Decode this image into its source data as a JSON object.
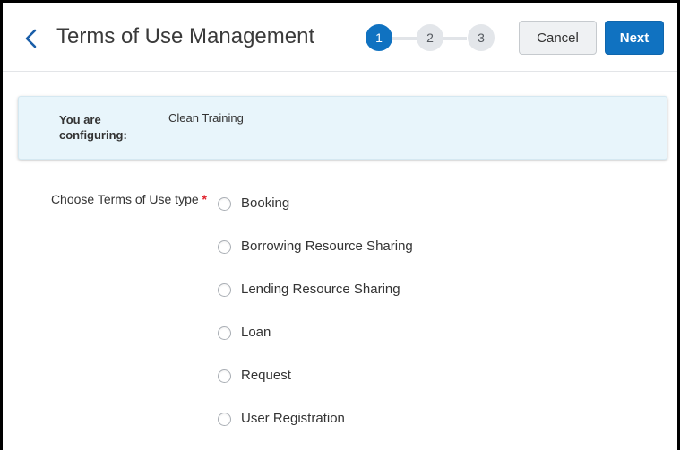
{
  "header": {
    "title": "Terms of Use Management",
    "steps": [
      "1",
      "2",
      "3"
    ],
    "active_step": 1,
    "cancel_label": "Cancel",
    "next_label": "Next"
  },
  "config_panel": {
    "label": "You are configuring:",
    "value": "Clean Training"
  },
  "form": {
    "field_label": "Choose Terms of Use type",
    "required_marker": "*",
    "options": [
      "Booking",
      "Borrowing Resource Sharing",
      "Lending Resource Sharing",
      "Loan",
      "Request",
      "User Registration"
    ]
  },
  "colors": {
    "accent": "#1072c1",
    "panel_bg": "#e8f5fb",
    "required": "#e0232d"
  },
  "icons": {
    "back": "chevron-left-icon",
    "radio": "radio-unchecked-icon"
  }
}
